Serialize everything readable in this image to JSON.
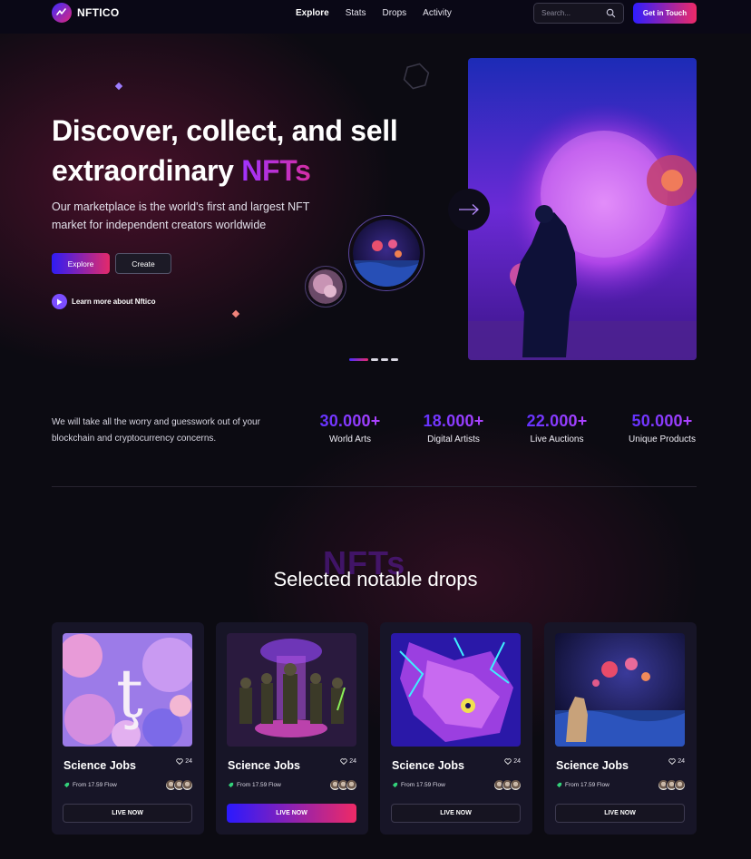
{
  "header": {
    "logo_text": "NFTICO",
    "nav": [
      "Explore",
      "Stats",
      "Drops",
      "Activity"
    ],
    "search_placeholder": "Search...",
    "cta_label": "Get in Touch"
  },
  "hero": {
    "title_line1": "Discover, collect, and sell",
    "title_line2_prefix": "extraordinary ",
    "title_line2_accent": "NFTs",
    "subtitle": "Our marketplace is the world's first and largest NFT market for independent creators worldwide",
    "explore_label": "Explore",
    "create_label": "Create",
    "learn_more_label": "Learn more about Nftico",
    "carousel_active_slide": 1,
    "carousel_slide_count": 4
  },
  "stats": {
    "description": "We will take all the worry and guesswork out of your blockchain and cryptocurrency concerns.",
    "items": [
      {
        "value": "30.000+",
        "label": "World Arts"
      },
      {
        "value": "18.000+",
        "label": "Digital Artists"
      },
      {
        "value": "22.000+",
        "label": "Live Auctions"
      },
      {
        "value": "50.000+",
        "label": "Unique Products"
      }
    ]
  },
  "drops": {
    "background_word": "NFTs",
    "title": "Selected notable drops",
    "cards": [
      {
        "title": "Science Jobs",
        "likes": "24",
        "price": "From 17.59 Flow",
        "button": "LIVE NOW",
        "active": false
      },
      {
        "title": "Science Jobs",
        "likes": "24",
        "price": "From 17.59 Flow",
        "button": "LIVE NOW",
        "active": true
      },
      {
        "title": "Science Jobs",
        "likes": "24",
        "price": "From 17.59 Flow",
        "button": "LIVE NOW",
        "active": false
      },
      {
        "title": "Science Jobs",
        "likes": "24",
        "price": "From 17.59 Flow",
        "button": "LIVE NOW",
        "active": false
      }
    ]
  },
  "colors": {
    "accent_start": "#2e1cf5",
    "accent_end": "#e42a6a",
    "stat_gradient_start": "#5b31ff",
    "stat_gradient_end": "#b845ff",
    "background": "#0c0b12",
    "card_background": "#171527"
  },
  "icons": [
    "logo-mark-icon",
    "search-icon",
    "play-icon",
    "arrow-right-icon",
    "heart-icon",
    "price-tag-icon"
  ]
}
